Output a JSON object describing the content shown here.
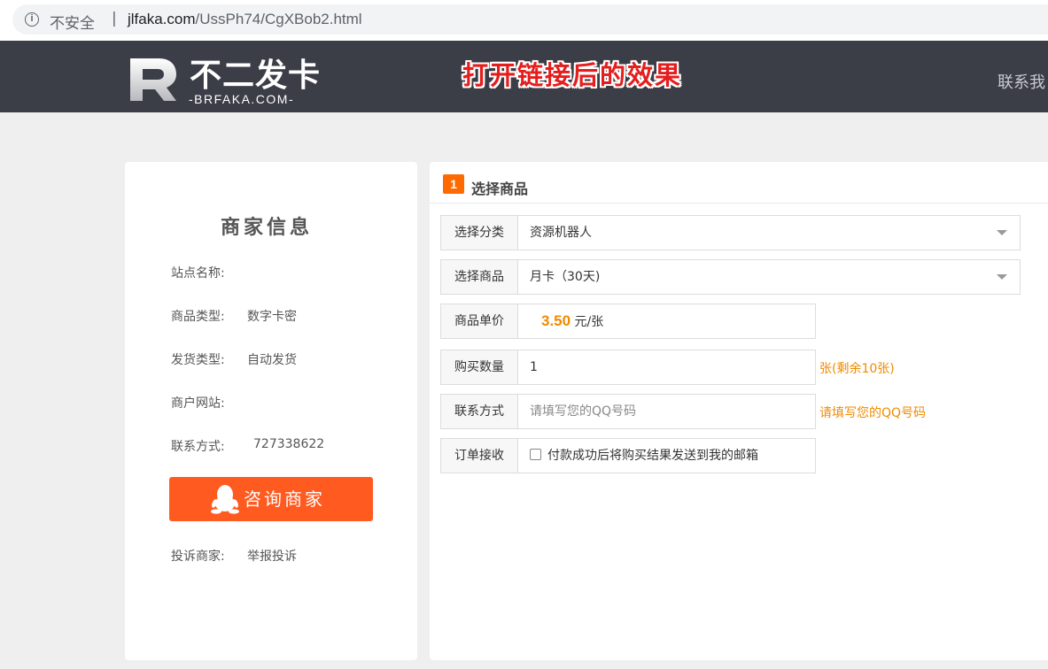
{
  "browser": {
    "security_label": "不安全",
    "separator": "|",
    "url_host": "jlfaka.com",
    "url_path": "/UssPh74/CgXBob2.html"
  },
  "header": {
    "logo_text": "不二发卡",
    "logo_sub": "-BRFAKA.COM-",
    "banner": "打开链接后的效果",
    "contact_link": "联系我"
  },
  "merchant": {
    "title": "商家信息",
    "rows": [
      {
        "label": "站点名称:",
        "value": ""
      },
      {
        "label": "商品类型:",
        "value": "数字卡密"
      },
      {
        "label": "发货类型:",
        "value": "自动发货"
      },
      {
        "label": "商户网站:",
        "value": ""
      },
      {
        "label": "联系方式:",
        "value": "727338622"
      }
    ],
    "consult_button": "咨询商家",
    "complaint_label": "投诉商家:",
    "complaint_link": "举报投诉"
  },
  "product": {
    "step_number": "1",
    "step_title": "选择商品",
    "category": {
      "label": "选择分类",
      "value": "资源机器人"
    },
    "item": {
      "label": "选择商品",
      "value": "月卡（30天)"
    },
    "price": {
      "label": "商品单价",
      "value": "3.50",
      "unit": "元/张"
    },
    "quantity": {
      "label": "购买数量",
      "value": "1",
      "hint": "张(剩余10张)"
    },
    "contact": {
      "label": "联系方式",
      "placeholder": "请填写您的QQ号码",
      "hint": "请填写您的QQ号码"
    },
    "order": {
      "label": "订单接收",
      "checkbox_label": "付款成功后将购买结果发送到我的邮箱",
      "checked": false
    }
  },
  "colors": {
    "header_bg": "#3b3d47",
    "accent_orange": "#ff5a1f",
    "price_orange": "#f08a00",
    "banner_red": "#e51d1d",
    "report_red": "#e02020"
  }
}
